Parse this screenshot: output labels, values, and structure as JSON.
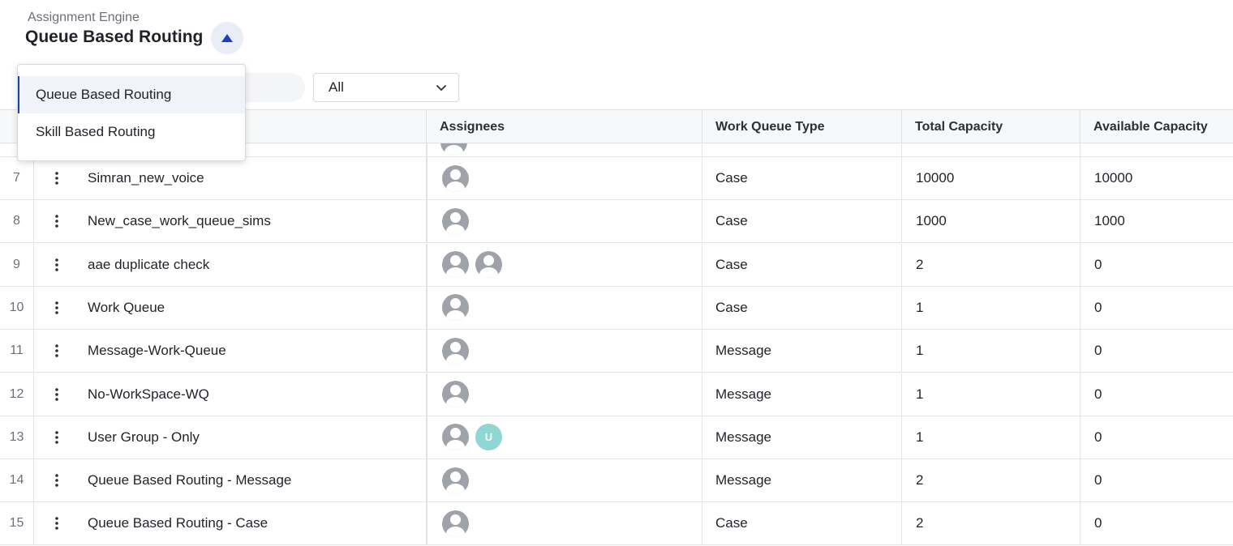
{
  "header": {
    "subtitle": "Assignment Engine",
    "title": "Queue Based Routing",
    "toggle_icon": "triangle-up-icon",
    "accent_color": "#1a3fbf"
  },
  "filters": {
    "select_value": "All"
  },
  "dropdown": {
    "items": [
      {
        "label": "Queue Based Routing",
        "active": true
      },
      {
        "label": "Skill Based Routing",
        "active": false
      }
    ]
  },
  "table": {
    "columns": [
      "Assignees",
      "Work Queue Type",
      "Total Capacity",
      "Available Capacity"
    ],
    "rows": [
      {
        "index": "7",
        "name": "Simran_new_voice",
        "assignees": [
          "user"
        ],
        "type": "Case",
        "total": "10000",
        "available": "10000"
      },
      {
        "index": "8",
        "name": "New_case_work_queue_sims",
        "assignees": [
          "user"
        ],
        "type": "Case",
        "total": "1000",
        "available": "1000"
      },
      {
        "index": "9",
        "name": "aae duplicate check",
        "assignees": [
          "user",
          "user"
        ],
        "type": "Case",
        "total": "2",
        "available": "0"
      },
      {
        "index": "10",
        "name": "Work Queue",
        "assignees": [
          "user"
        ],
        "type": "Case",
        "total": "1",
        "available": "0"
      },
      {
        "index": "11",
        "name": "Message-Work-Queue",
        "assignees": [
          "user"
        ],
        "type": "Message",
        "total": "1",
        "available": "0"
      },
      {
        "index": "12",
        "name": "No-WorkSpace-WQ",
        "assignees": [
          "user"
        ],
        "type": "Message",
        "total": "1",
        "available": "0"
      },
      {
        "index": "13",
        "name": "User Group - Only",
        "assignees": [
          "user",
          "U"
        ],
        "type": "Message",
        "total": "1",
        "available": "0"
      },
      {
        "index": "14",
        "name": "Queue Based Routing - Message",
        "assignees": [
          "user"
        ],
        "type": "Message",
        "total": "2",
        "available": "0"
      },
      {
        "index": "15",
        "name": "Queue Based Routing - Case",
        "assignees": [
          "user"
        ],
        "type": "Case",
        "total": "2",
        "available": "0"
      }
    ]
  }
}
